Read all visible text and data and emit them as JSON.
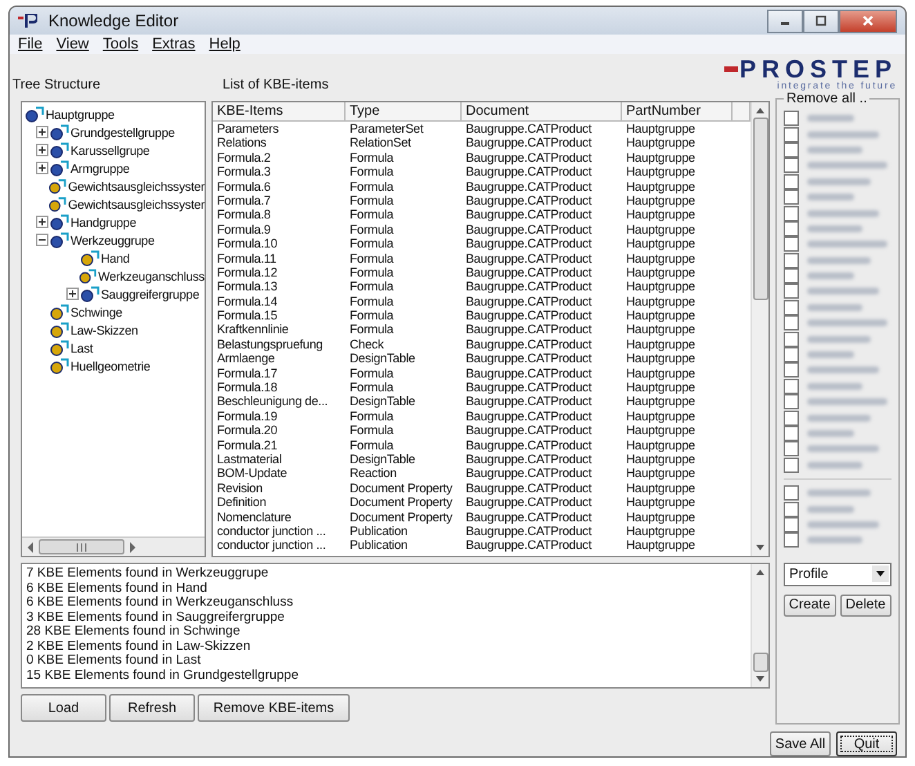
{
  "window": {
    "title": "Knowledge Editor"
  },
  "menu": [
    "File",
    "View",
    "Tools",
    "Extras",
    "Help"
  ],
  "logo": {
    "name": "PROSTEP",
    "tagline": "integrate the future"
  },
  "tree": {
    "label": "Tree Structure",
    "items": [
      {
        "label": "Hauptgruppe",
        "children": [
          {
            "label": "Grundgestellgruppe",
            "expanded": false
          },
          {
            "label": "Karussellgrupe",
            "expanded": false
          },
          {
            "label": "Armgruppe",
            "expanded": false
          },
          {
            "label": "Gewichtsausgleichssyster"
          },
          {
            "label": "Gewichtsausgleichssyster"
          },
          {
            "label": "Handgruppe",
            "expanded": false
          },
          {
            "label": "Werkzeuggrupe",
            "expanded": true,
            "children": [
              {
                "label": "Hand"
              },
              {
                "label": "Werkzeuganschluss"
              },
              {
                "label": "Sauggreifergruppe",
                "expanded": false
              }
            ]
          },
          {
            "label": "Schwinge"
          },
          {
            "label": "Law-Skizzen"
          },
          {
            "label": "Last"
          },
          {
            "label": "Huellgeometrie"
          }
        ]
      }
    ]
  },
  "table": {
    "label": "List of KBE-items",
    "columns": [
      "KBE-Items",
      "Type",
      "Document",
      "PartNumber"
    ],
    "rows": [
      [
        "Parameters",
        "ParameterSet",
        "Baugruppe.CATProduct",
        "Hauptgruppe"
      ],
      [
        "Relations",
        "RelationSet",
        "Baugruppe.CATProduct",
        "Hauptgruppe"
      ],
      [
        "Formula.2",
        "Formula",
        "Baugruppe.CATProduct",
        "Hauptgruppe"
      ],
      [
        "Formula.3",
        "Formula",
        "Baugruppe.CATProduct",
        "Hauptgruppe"
      ],
      [
        "Formula.6",
        "Formula",
        "Baugruppe.CATProduct",
        "Hauptgruppe"
      ],
      [
        "Formula.7",
        "Formula",
        "Baugruppe.CATProduct",
        "Hauptgruppe"
      ],
      [
        "Formula.8",
        "Formula",
        "Baugruppe.CATProduct",
        "Hauptgruppe"
      ],
      [
        "Formula.9",
        "Formula",
        "Baugruppe.CATProduct",
        "Hauptgruppe"
      ],
      [
        "Formula.10",
        "Formula",
        "Baugruppe.CATProduct",
        "Hauptgruppe"
      ],
      [
        "Formula.11",
        "Formula",
        "Baugruppe.CATProduct",
        "Hauptgruppe"
      ],
      [
        "Formula.12",
        "Formula",
        "Baugruppe.CATProduct",
        "Hauptgruppe"
      ],
      [
        "Formula.13",
        "Formula",
        "Baugruppe.CATProduct",
        "Hauptgruppe"
      ],
      [
        "Formula.14",
        "Formula",
        "Baugruppe.CATProduct",
        "Hauptgruppe"
      ],
      [
        "Formula.15",
        "Formula",
        "Baugruppe.CATProduct",
        "Hauptgruppe"
      ],
      [
        "Kraftkennlinie",
        "Formula",
        "Baugruppe.CATProduct",
        "Hauptgruppe"
      ],
      [
        "Belastungspruefung",
        "Check",
        "Baugruppe.CATProduct",
        "Hauptgruppe"
      ],
      [
        "Armlaenge",
        "DesignTable",
        "Baugruppe.CATProduct",
        "Hauptgruppe"
      ],
      [
        "Formula.17",
        "Formula",
        "Baugruppe.CATProduct",
        "Hauptgruppe"
      ],
      [
        "Formula.18",
        "Formula",
        "Baugruppe.CATProduct",
        "Hauptgruppe"
      ],
      [
        "Beschleunigung de...",
        "DesignTable",
        "Baugruppe.CATProduct",
        "Hauptgruppe"
      ],
      [
        "Formula.19",
        "Formula",
        "Baugruppe.CATProduct",
        "Hauptgruppe"
      ],
      [
        "Formula.20",
        "Formula",
        "Baugruppe.CATProduct",
        "Hauptgruppe"
      ],
      [
        "Formula.21",
        "Formula",
        "Baugruppe.CATProduct",
        "Hauptgruppe"
      ],
      [
        "Lastmaterial",
        "DesignTable",
        "Baugruppe.CATProduct",
        "Hauptgruppe"
      ],
      [
        "BOM-Update",
        "Reaction",
        "Baugruppe.CATProduct",
        "Hauptgruppe"
      ],
      [
        "Revision",
        "Document Property",
        "Baugruppe.CATProduct",
        "Hauptgruppe"
      ],
      [
        "Definition",
        "Document Property",
        "Baugruppe.CATProduct",
        "Hauptgruppe"
      ],
      [
        "Nomenclature",
        "Document Property",
        "Baugruppe.CATProduct",
        "Hauptgruppe"
      ],
      [
        "conductor junction ...",
        "Publication",
        "Baugruppe.CATProduct",
        "Hauptgruppe"
      ],
      [
        "conductor junction ...",
        "Publication",
        "Baugruppe.CATProduct",
        "Hauptgruppe"
      ]
    ]
  },
  "log": [
    "7  KBE Elements found in Werkzeuggrupe",
    "6  KBE Elements found in Hand",
    "6  KBE Elements found in Werkzeuganschluss",
    "3  KBE Elements found in Sauggreifergruppe",
    "28  KBE Elements found in Schwinge",
    "2  KBE Elements found in Law-Skizzen",
    "0  KBE Elements found in Last",
    "15  KBE Elements found in Grundgestellgruppe"
  ],
  "actions": [
    "Load",
    "Refresh",
    "Remove KBE-items"
  ],
  "remove_panel": {
    "title": "Remove all ..",
    "groups": [
      [
        {
          "checked": false
        },
        {
          "checked": false
        },
        {
          "checked": false
        },
        {
          "checked": false
        },
        {
          "checked": false
        },
        {
          "checked": false
        },
        {
          "checked": false
        },
        {
          "checked": false
        },
        {
          "checked": false
        },
        {
          "checked": false
        },
        {
          "checked": false
        },
        {
          "checked": false
        },
        {
          "checked": false
        },
        {
          "checked": false
        },
        {
          "checked": false
        },
        {
          "checked": false
        },
        {
          "checked": false
        },
        {
          "checked": false
        },
        {
          "checked": false
        },
        {
          "checked": false
        },
        {
          "checked": false
        },
        {
          "checked": false
        },
        {
          "checked": false
        }
      ],
      [
        {
          "checked": false
        },
        {
          "checked": false
        },
        {
          "checked": false
        },
        {
          "checked": false
        }
      ]
    ],
    "profile": "Profile",
    "buttons": [
      "Create",
      "Delete"
    ]
  },
  "footer_buttons": [
    {
      "label": "Save All",
      "focused": false
    },
    {
      "label": "Quit",
      "focused": true
    }
  ]
}
